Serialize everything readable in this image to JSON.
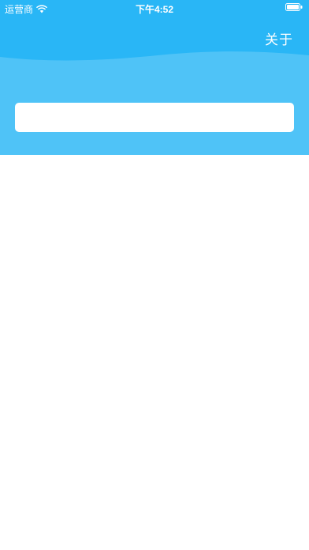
{
  "status_bar": {
    "carrier": "运营商",
    "time": "下午4:52",
    "wifi_icon": "wifi-icon",
    "battery_icon": "battery-icon"
  },
  "header": {
    "about_label": "关于"
  },
  "search": {
    "value": "",
    "placeholder": ""
  },
  "colors": {
    "header_top": "#29b6f6",
    "header_bottom": "#4fc3f7",
    "background": "#ffffff"
  }
}
